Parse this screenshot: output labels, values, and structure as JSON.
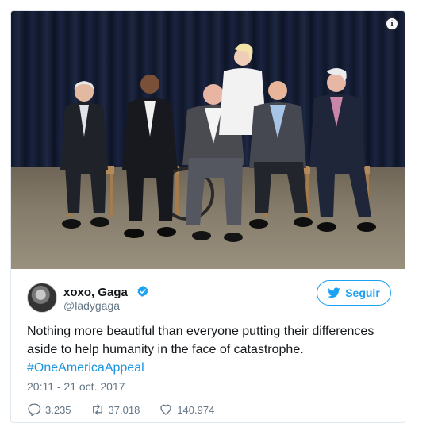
{
  "tweet": {
    "display_name": "xoxo, Gaga",
    "handle": "@ladygaga",
    "follow_label": "Seguir",
    "text_main": "Nothing more beautiful than everyone putting their differences aside to help humanity in the face of catastrophe.",
    "hashtag": "#OneAmericaAppeal",
    "timestamp": "20:11 - 21 oct. 2017",
    "replies": "3.235",
    "retweets": "37.018",
    "likes": "140.974"
  },
  "icons": {
    "info": "info-icon",
    "verified": "verified-badge-icon",
    "twitter_bird": "twitter-bird-icon",
    "reply": "reply-icon",
    "retweet": "retweet-icon",
    "like": "heart-icon"
  },
  "colors": {
    "accent": "#1da1f2",
    "hashtag": "#1b95e0",
    "secondary_text": "#657786",
    "border": "#e1e8ed"
  }
}
